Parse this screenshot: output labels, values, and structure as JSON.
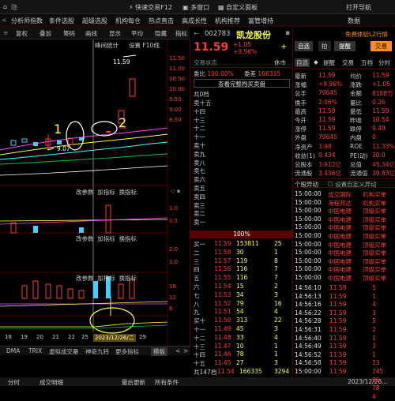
{
  "topbar": {
    "home": "⌂",
    "hide": "隐",
    "quick": "快速交易F12",
    "multi": "多窗口",
    "custom": "自定义面板",
    "open_guide": "打开导航",
    "data": "数据"
  },
  "menu": [
    "分析师指数",
    "条件选股",
    "超级选股",
    "机构每仓",
    "热点直击",
    "高成长性",
    "机构推荐",
    "富管增持"
  ],
  "toolbar": [
    "复权",
    "叠加",
    "筹码",
    "画线",
    "显示",
    "平均",
    "隐藏",
    "指标"
  ],
  "chart": {
    "mini_label": "峰间统计",
    "setting": "设置 F10线",
    "price_high": "11.59",
    "price_note": "9.07",
    "anno1": "1",
    "anno2": "2",
    "date_marker": "2023/12/26/二",
    "x_ticks": [
      "18",
      "19",
      "20",
      "21",
      "22",
      "25",
      "26",
      "29"
    ],
    "y_main": [
      "11.50",
      "11.00",
      "10.50",
      "10.00",
      "9.50",
      "9.00",
      "8.50"
    ],
    "y_vol": [
      "1.0",
      "0.5"
    ],
    "y_sub2": [
      "2.0",
      "1.0"
    ],
    "y_sub3": [
      "18",
      "12",
      "6"
    ],
    "panel_tools": [
      "改参数",
      "加指标",
      "换指标"
    ],
    "mini_icons": [
      "◇",
      "◇",
      "▪",
      "▪"
    ],
    "bottom_tabs": [
      "DMA",
      "TRIX",
      "虚拟成交量",
      "神奇九转",
      "更多指标",
      "模板"
    ],
    "tab_arrows": [
      "<",
      ">"
    ]
  },
  "status": {
    "left": [
      "分时",
      "成交明细",
      "最后更新",
      "所有条件"
    ],
    "right": "2023/12/26..."
  },
  "quote": {
    "code": "002783",
    "name": "凯龙股份",
    "price": "11.59",
    "change": "+1.05",
    "pct": "+9.96%",
    "plus": "+",
    "exempt": "免费体验L2行情",
    "tabs": [
      "自选",
      "拍",
      "提醒",
      "交易"
    ],
    "board": "交易状态",
    "status_right": "休市",
    "weibi": "100.00%",
    "weicha": "166335",
    "weibi_label": "委比",
    "weicha_label": "委差",
    "view_all": "查看完整档买卖盘",
    "total_label": "共0档",
    "sell": [
      "卖十五",
      "十四",
      "十三",
      "十二",
      "十一",
      "卖十",
      "卖九",
      "卖八",
      "卖七",
      "卖六",
      "卖五",
      "卖四",
      "卖三",
      "卖二",
      "卖一"
    ],
    "ratio": "100%",
    "buy": [
      [
        "买一",
        "11.59",
        "153811",
        "25"
      ],
      [
        "二",
        "11.58",
        "30",
        "1"
      ],
      [
        "三",
        "11.57",
        "119",
        "8"
      ],
      [
        "四",
        "11.56",
        "116",
        "7"
      ],
      [
        "五",
        "11.55",
        "116",
        "7"
      ],
      [
        "六",
        "11.54",
        "15",
        "2"
      ],
      [
        "七",
        "11.53",
        "34",
        "3"
      ],
      [
        "八",
        "11.52",
        "79",
        "16"
      ],
      [
        "九",
        "11.51",
        "54",
        "4"
      ],
      [
        "买十",
        "11.50",
        "313",
        "22"
      ],
      [
        "十一",
        "11.49",
        "45",
        "3"
      ],
      [
        "十二",
        "11.48",
        "33",
        "4"
      ],
      [
        "十三",
        "11.47",
        "10",
        "1"
      ],
      [
        "十四",
        "11.46",
        "78",
        "1"
      ],
      [
        "十五",
        "11.45",
        "27",
        "3"
      ]
    ],
    "buy_total": "共147档",
    "buy_total_price": "11.54",
    "buy_total_vol": "166335",
    "buy_total_num": "3294"
  },
  "right": {
    "header_tabs": [
      "自选",
      "◆",
      "提醒",
      "交易",
      "五档",
      "分时",
      "成交"
    ],
    "stats": [
      [
        "最新",
        "11.59",
        "均价",
        "11.59"
      ],
      [
        "涨幅",
        "+9.96%",
        "涨跌",
        "+1.05"
      ],
      [
        "总手",
        "70645",
        "金额",
        "8188万"
      ],
      [
        "换手",
        "2.06%",
        "量比",
        "0.26"
      ],
      [
        "最高",
        "11.59",
        "最低",
        "11.59"
      ],
      [
        "今开",
        "11.59",
        "昨收",
        "10.54"
      ],
      [
        "涨停",
        "11.59",
        "跌停",
        "9.49"
      ],
      [
        "外盘",
        "70645",
        "内盘",
        "0"
      ],
      [
        "净资产",
        "3.98",
        "ROE",
        "11.33%"
      ],
      [
        "收益(1)",
        "0.434",
        "PE(动)",
        "20.0"
      ],
      [
        "总股本",
        "3.912亿",
        "总值",
        "45.34亿"
      ],
      [
        "流通股",
        "3.436亿",
        "流通值",
        "39.83亿"
      ]
    ],
    "tabs2": [
      "个股异动",
      "设置自定义异动"
    ],
    "events": [
      [
        "15:00:00",
        "成交国际",
        "机构买单"
      ],
      [
        "15:00:00",
        "海程邦达",
        "机构买单"
      ],
      [
        "15:00:00",
        "中国电建",
        "顶级买单"
      ],
      [
        "15:00:00",
        "中国电建",
        "顶级买单"
      ],
      [
        "15:00:00",
        "中国电建",
        "顶级买单"
      ],
      [
        "15:00:00",
        "中国电建",
        "顶级买单"
      ],
      [
        "15:00:00",
        "中国电建",
        "顶级买单"
      ],
      [
        "15:00:00",
        "中国电建",
        "顶级买单"
      ],
      [
        "15:00:00",
        "中国电建",
        "顶级买单"
      ],
      [
        "15:00:00",
        "中国电建",
        "顶级买单"
      ],
      [
        "15:00:00",
        "中国电建",
        "顶级买单"
      ]
    ],
    "ticks": [
      [
        "14:56:10",
        "11.59",
        "5"
      ],
      [
        "14:56:13",
        "11.59",
        "1"
      ],
      [
        "14:56:16",
        "11.59",
        "4"
      ],
      [
        "14:56:22",
        "11.59",
        "3"
      ],
      [
        "14:56:28",
        "11.59",
        "5"
      ],
      [
        "14:56:31",
        "11.59",
        "2"
      ],
      [
        "14:56:40",
        "11.59",
        "1"
      ],
      [
        "14:56:49",
        "11.59",
        "3"
      ],
      [
        "14:56:52",
        "11.59",
        "1"
      ],
      [
        "14:56:58",
        "11.59",
        "13"
      ],
      [
        "15:00:00",
        "11.59",
        "245"
      ],
      [
        "",
        "",
        "96"
      ],
      [
        "",
        "",
        "78"
      ],
      [
        "",
        "",
        "4"
      ]
    ]
  },
  "colors": {
    "up": "#ff3c3c",
    "down": "#00d050",
    "accent": "#ff8c1a",
    "yellow": "#ffff40"
  }
}
